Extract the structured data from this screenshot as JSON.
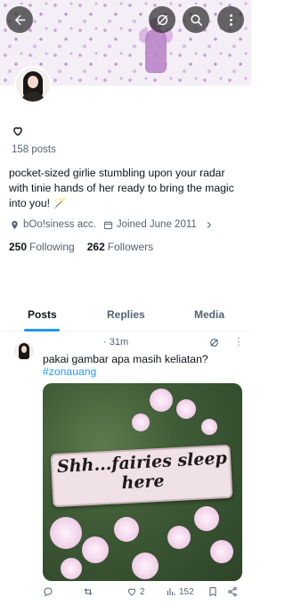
{
  "header": {
    "back_icon": "arrow-left-icon",
    "grok_icon": "grok-icon",
    "search_icon": "search-icon",
    "more_icon": "more-vertical-icon"
  },
  "profile": {
    "posts_count": "158 posts",
    "bio": "pocket-sized girlie stumbling upon your radar with tinie hands of her ready to bring the magic into you! 🪄",
    "location": "bOo!siness acc.",
    "joined": "Joined June 2011",
    "following_count": "250",
    "following_label": "Following",
    "followers_count": "262",
    "followers_label": "Followers"
  },
  "tabs": [
    {
      "label": "Posts",
      "active": true
    },
    {
      "label": "Replies",
      "active": false
    },
    {
      "label": "Media",
      "active": false
    }
  ],
  "tweet": {
    "time": "· 31m",
    "text": "pakai gambar apa masih keliatan?",
    "hashtag": "#zonauang",
    "image_text_line1": "Shh...fairies sleep",
    "image_text_line2": "here",
    "views": "152",
    "likes": "2"
  },
  "colors": {
    "accent": "#1d9bf0",
    "text": "#0f1419",
    "muted": "#536471"
  }
}
